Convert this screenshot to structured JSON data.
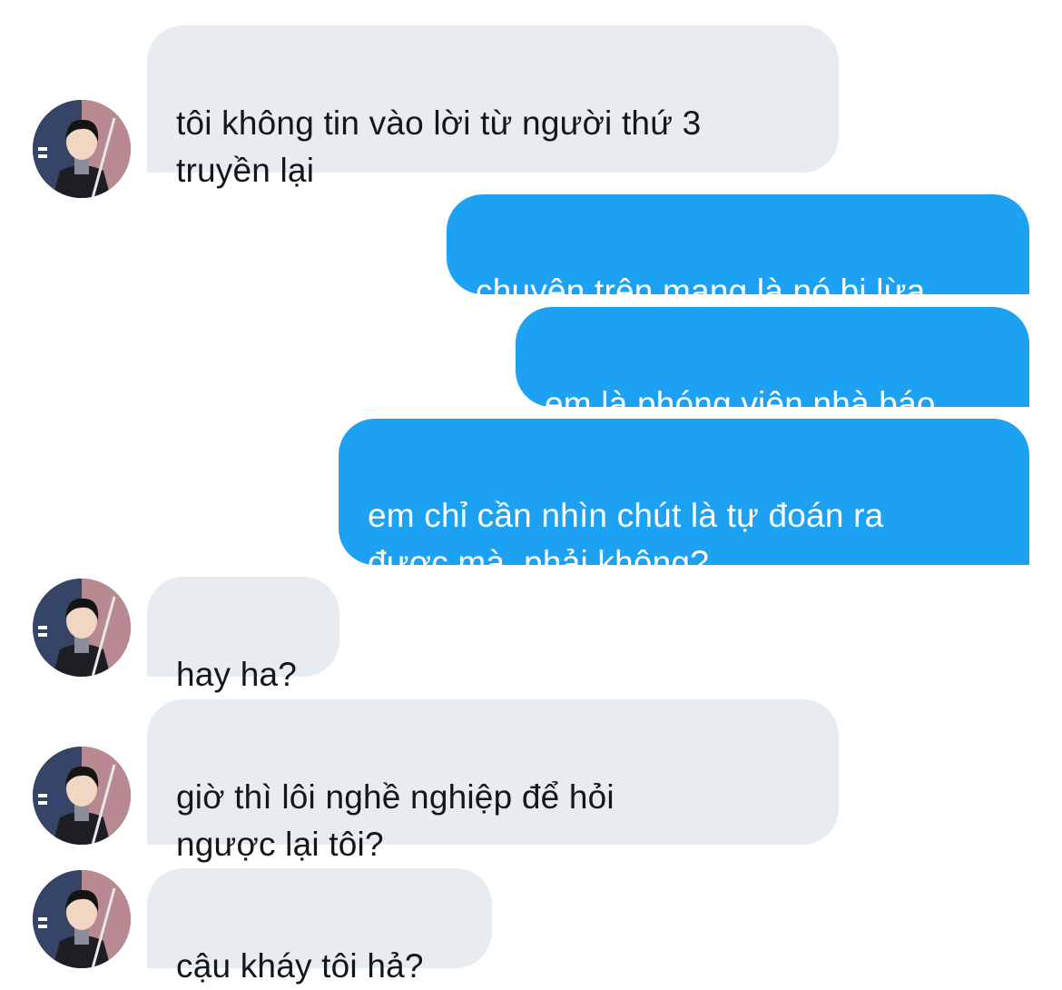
{
  "conversation": {
    "messages": [
      {
        "direction": "incoming",
        "text": "tôi không tin vào lời từ người thứ 3\ntruyền lại",
        "avatar_icon": "user-avatar-icon"
      },
      {
        "direction": "outgoing",
        "text": "chuyện trên mạng là nó bị lừa"
      },
      {
        "direction": "outgoing",
        "text": "em là phóng viên nhà báo"
      },
      {
        "direction": "outgoing",
        "text": "em chỉ cần nhìn chút là tự đoán ra\nđược mà, phải không?"
      },
      {
        "direction": "incoming",
        "text": "hay ha?",
        "avatar_icon": "user-avatar-icon"
      },
      {
        "direction": "incoming",
        "text": "giờ thì lôi nghề nghiệp để hỏi\nngược lại tôi?",
        "avatar_icon": "user-avatar-icon"
      },
      {
        "direction": "incoming",
        "text": "cậu kháy tôi hả?",
        "avatar_icon": "user-avatar-icon"
      }
    ]
  },
  "colors": {
    "incoming_bubble": "#e6ecf0",
    "incoming_text": "#14171a",
    "outgoing_bubble": "#1da1f2",
    "outgoing_text": "#ffffff",
    "background": "#ffffff"
  }
}
